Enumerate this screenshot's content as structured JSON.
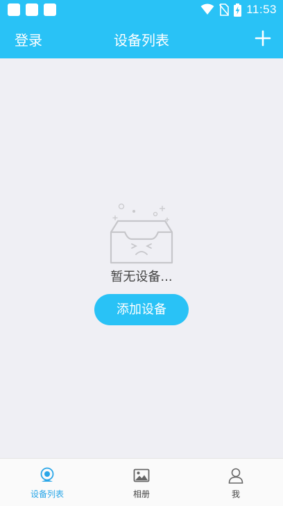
{
  "status_bar": {
    "time": "11:53",
    "icons": [
      "notification-icon",
      "notification-icon",
      "notification-icon",
      "wifi-icon",
      "no-sim-icon",
      "battery-charging-icon"
    ]
  },
  "app_bar": {
    "login_label": "登录",
    "title": "设备列表",
    "add_icon": "plus-icon"
  },
  "empty_state": {
    "icon": "empty-box-icon",
    "message": "暂无设备...",
    "button_label": "添加设备"
  },
  "tabs": [
    {
      "label": "设备列表",
      "icon": "camera-icon",
      "active": true
    },
    {
      "label": "相册",
      "icon": "album-icon",
      "active": false
    },
    {
      "label": "我",
      "icon": "user-icon",
      "active": false
    }
  ],
  "colors": {
    "primary": "#29c2f6",
    "background": "#efeff4",
    "tab_active": "#29a6e8"
  }
}
